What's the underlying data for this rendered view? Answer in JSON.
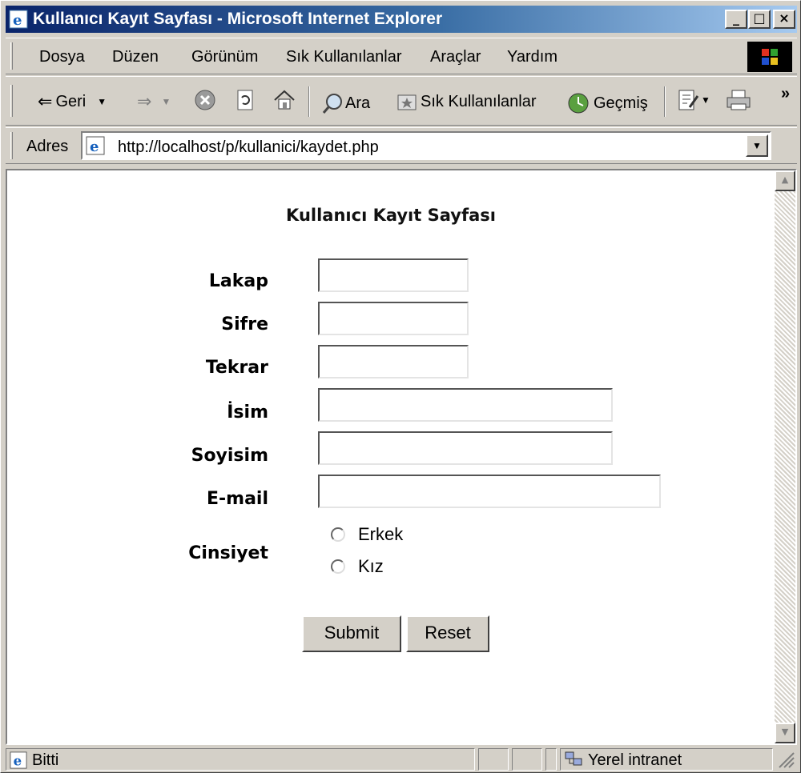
{
  "window": {
    "title": "Kullanıcı Kayıt Sayfası - Microsoft Internet Explorer",
    "caption_buttons": {
      "minimize": "_",
      "maximize": "□",
      "close": "×"
    }
  },
  "menu": {
    "items": [
      "Dosya",
      "Düzen",
      "Görünüm",
      "Sık Kullanılanlar",
      "Araçlar",
      "Yardım"
    ]
  },
  "toolbar": {
    "back": "Geri",
    "search": "Ara",
    "favorites": "Sık Kullanılanlar",
    "history": "Geçmiş",
    "overflow": "»"
  },
  "address": {
    "label": "Adres",
    "url": "http://localhost/p/kullanici/kaydet.php"
  },
  "page": {
    "title": "Kullanıcı Kayıt Sayfası",
    "fields": {
      "lakap": {
        "label": "Lakap",
        "value": ""
      },
      "sifre": {
        "label": "Sifre",
        "value": ""
      },
      "tekrar": {
        "label": "Tekrar",
        "value": ""
      },
      "isim": {
        "label": "İsim",
        "value": ""
      },
      "soyisim": {
        "label": "Soyisim",
        "value": ""
      },
      "email": {
        "label": "E-mail",
        "value": ""
      }
    },
    "gender": {
      "label": "Cinsiyet",
      "options": [
        "Erkek",
        "Kız"
      ]
    },
    "submit_label": "Submit",
    "reset_label": "Reset"
  },
  "status": {
    "text": "Bitti",
    "zone": "Yerel intranet"
  },
  "colors": {
    "title_gradient_start": "#0a246a",
    "title_gradient_end": "#a6caf0",
    "chrome": "#d4d0c8"
  }
}
